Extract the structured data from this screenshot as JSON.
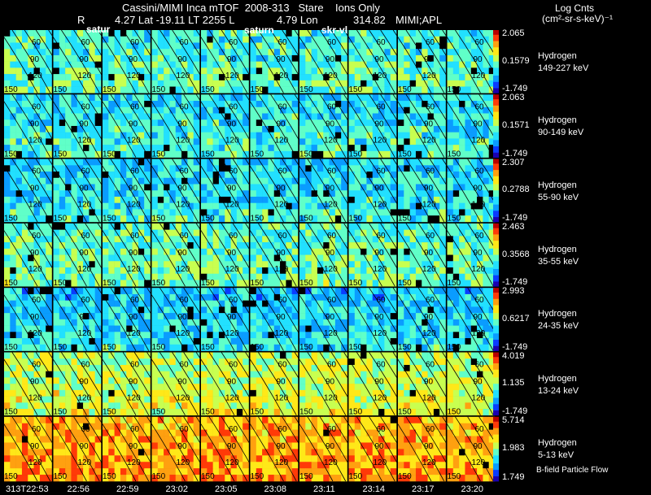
{
  "header": {
    "title": "Cassini/MIMI Inca mTOF  2008-313   Stare    Ions Only",
    "info_labels": [
      "R",
      "4.27 Lat -19.11 LT 2255 L",
      "4.79 Lon",
      "314.82",
      "MIMI;APL"
    ],
    "overlay_labels": [
      "satur",
      "saturn",
      "skr-vl"
    ]
  },
  "colorbar": {
    "title_line1": "Log Cnts",
    "title_line2": "(cm²-sr-s-keV)⁻¹"
  },
  "footer_note": "B-field Particle Flow",
  "chart_data": {
    "type": "heatmap",
    "title": "Cassini/MIMI Inca mTOF  2008-313   Stare    Ions Only",
    "times": [
      "313T22:53",
      "22:56",
      "22:59",
      "23:02",
      "23:05",
      "23:08",
      "23:11",
      "23:14",
      "23:17",
      "23:20"
    ],
    "contour_labels": [
      "60",
      "90",
      "120",
      "150"
    ],
    "colors": {
      "colormap": [
        "#1a00b0",
        "#0a3cff",
        "#0a9cff",
        "#22e0ff",
        "#60ffc8",
        "#c8ff50",
        "#ffe818",
        "#ffa010",
        "#ff3a08",
        "#b80000"
      ],
      "contour": "#000000",
      "data_gap": "#000000"
    },
    "panels": [
      {
        "species": "Hydrogen",
        "energy": "149-227 keV",
        "max": "2.065",
        "mid": "0.1579",
        "min": "-1.749",
        "level": 0.42,
        "gaps": 0.03
      },
      {
        "species": "Hydrogen",
        "energy": "90-149 keV",
        "max": "2.063",
        "mid": "0.1571",
        "min": "-1.749",
        "level": 0.38,
        "gaps": 0.04
      },
      {
        "species": "Hydrogen",
        "energy": "55-90 keV",
        "max": "2.307",
        "mid": "0.2788",
        "min": "-1.749",
        "level": 0.36,
        "gaps": 0.05
      },
      {
        "species": "Hydrogen",
        "energy": "35-55 keV",
        "max": "2.463",
        "mid": "0.3568",
        "min": "-1.749",
        "level": 0.45,
        "gaps": 0.05
      },
      {
        "species": "Hydrogen",
        "energy": "24-35 keV",
        "max": "2.993",
        "mid": "0.6217",
        "min": "-1.749",
        "level": 0.33,
        "gaps": 0.06
      },
      {
        "species": "Hydrogen",
        "energy": "13-24 keV",
        "max": "4.019",
        "mid": "1.135",
        "min": "-1.749",
        "level": 0.58,
        "gaps": 0.02
      },
      {
        "species": "Hydrogen",
        "energy": "5-13 keV",
        "max": "5.714",
        "mid": "1.983",
        "min": "1.749",
        "level": 0.76,
        "gaps": 0.01
      }
    ]
  }
}
